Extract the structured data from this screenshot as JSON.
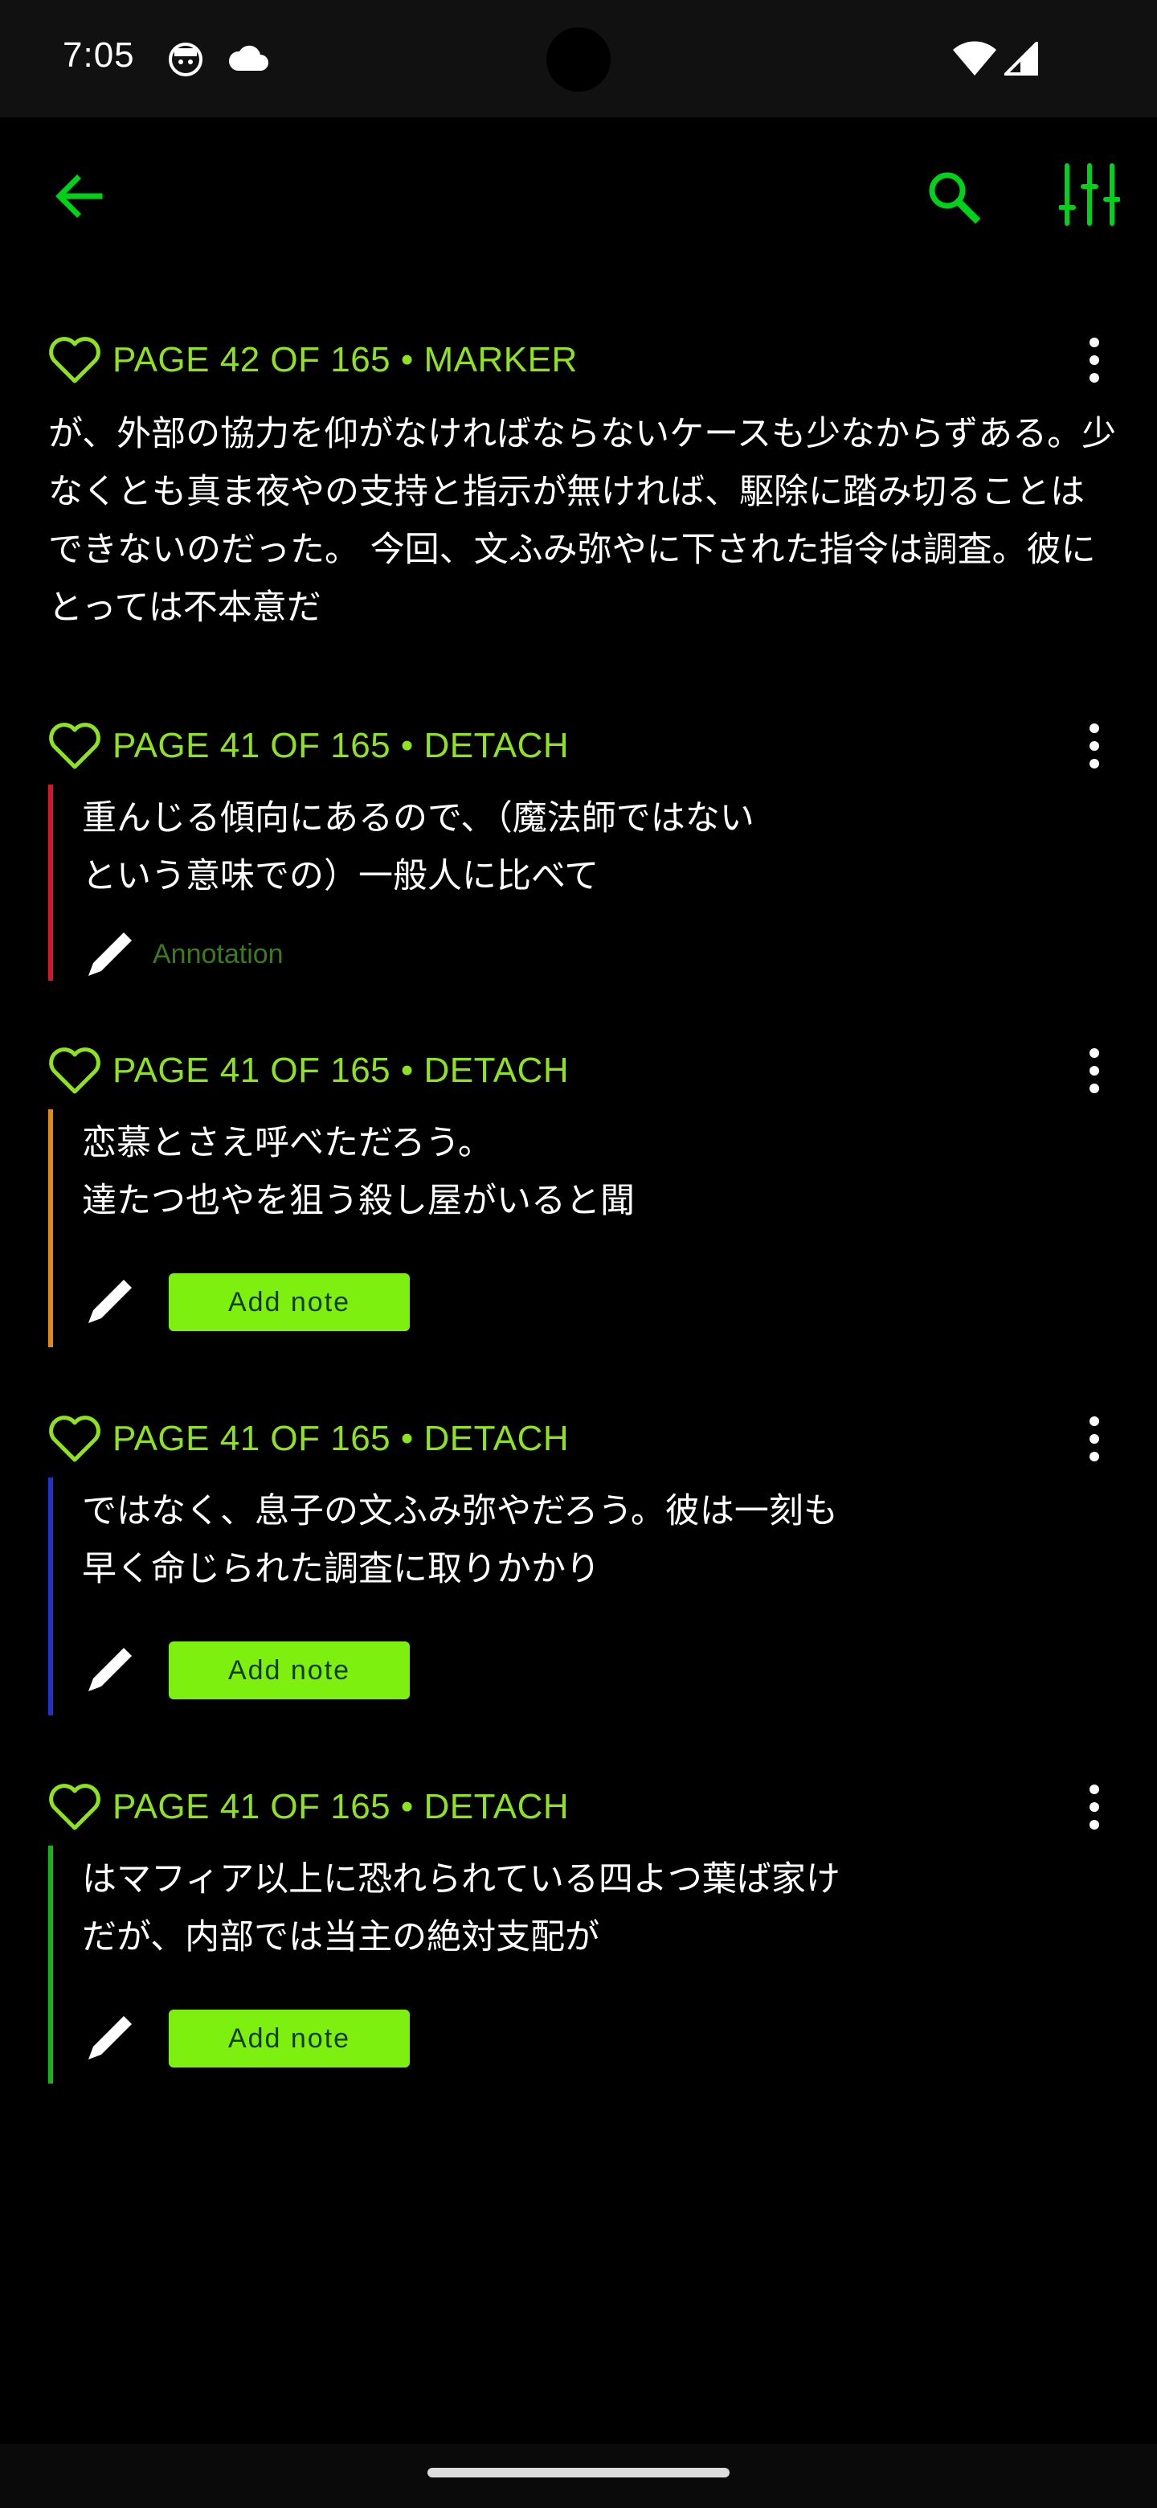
{
  "status_bar": {
    "time": "7:05"
  },
  "colors": {
    "accent": "#00d21a",
    "meta": "#8fe31e",
    "button_bg": "#7ef010",
    "marker_red": "#d0182a",
    "marker_orange": "#e08a18",
    "marker_blue": "#1f33c8",
    "marker_green": "#17b21c"
  },
  "toolbar": {
    "back_icon": "arrow-left-icon",
    "search_icon": "search-icon",
    "filter_icon": "sliders-icon"
  },
  "entries": [
    {
      "meta": "PAGE 42 OF 165 • MARKER",
      "text": "が、外部の協力を仰がなければならないケースも少なからずある。少なくとも真ま夜やの支持と指示が無ければ、駆除に踏み切ることはできないのだった。 今回、文ふみ弥やに下された指令は調査。彼にとっては不本意だ"
    },
    {
      "meta": "PAGE 41 OF 165 • DETACH",
      "line1": "重んじる傾向にあるので、（魔法師ではない",
      "line2": "という意味での）一般人に比べて",
      "annotation": "Annotation"
    },
    {
      "meta": "PAGE 41 OF 165 • DETACH",
      "line1": "恋慕とさえ呼べただろう。",
      "line2": "達たつ也やを狙う殺し屋がいると聞",
      "button": "Add note"
    },
    {
      "meta": "PAGE 41 OF 165 • DETACH",
      "line1": "ではなく、息子の文ふみ弥やだろう。彼は一刻も",
      "line2": "早く命じられた調査に取りかかり",
      "button": "Add note"
    },
    {
      "meta": "PAGE 41 OF 165 • DETACH",
      "line1": "はマフィア以上に恐れられている四よつ葉ば家け",
      "line2": "だが、内部では当主の絶対支配が",
      "button": "Add note"
    }
  ]
}
